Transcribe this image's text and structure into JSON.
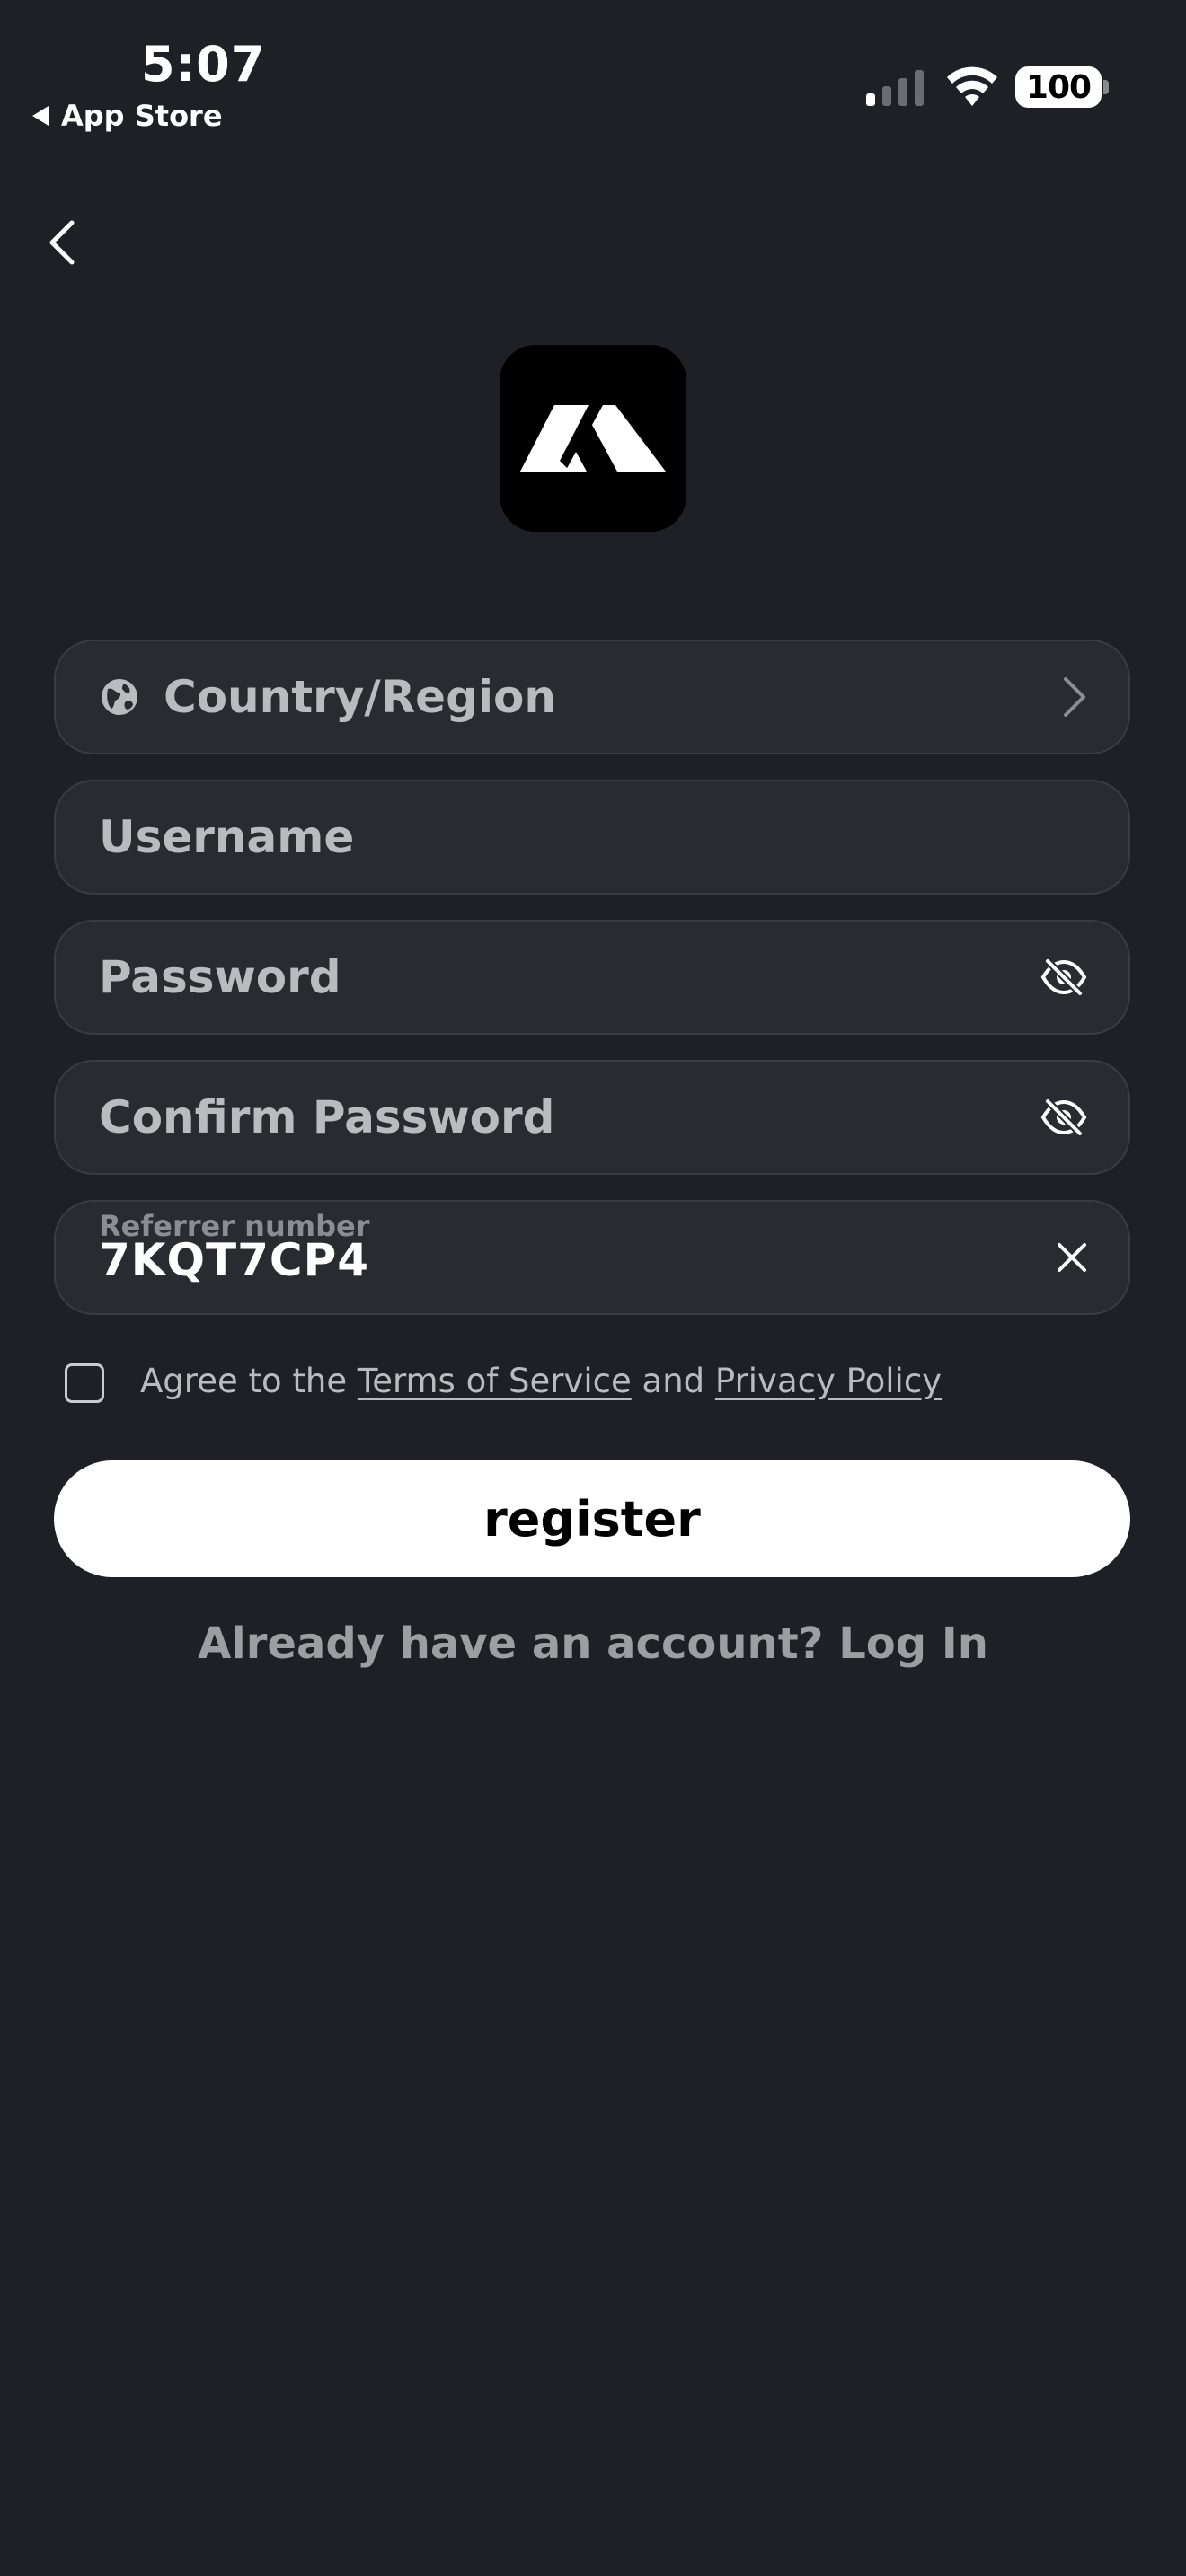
{
  "status_bar": {
    "time": "5:07",
    "back_app": "App Store",
    "battery": "100"
  },
  "form": {
    "country_placeholder": "Country/Region",
    "username_placeholder": "Username",
    "password_placeholder": "Password",
    "confirm_password_placeholder": "Confirm Password",
    "referrer_label": "Referrer number",
    "referrer_value": "7KQT7CP4"
  },
  "agree": {
    "prefix": "Agree to the ",
    "terms": "Terms of Service",
    "middle": " and ",
    "privacy": "Privacy Policy"
  },
  "register_label": "register",
  "login_prompt": "Already have an account? Log In",
  "icons": {
    "back": "chevron-left-icon",
    "globe": "globe-icon",
    "chevron": "chevron-right-icon",
    "eye_off": "eye-off-icon",
    "clear": "close-icon"
  },
  "colors": {
    "background": "#1f2026",
    "field": "#292b31",
    "primary_button": "#ffffff"
  }
}
